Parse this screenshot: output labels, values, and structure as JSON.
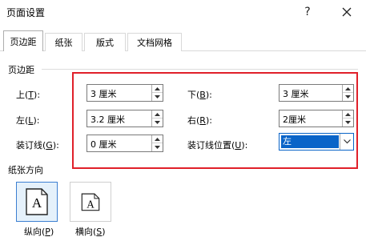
{
  "window": {
    "title": "页面设置"
  },
  "icons": {
    "help": "question-mark-icon",
    "close": "close-x-icon"
  },
  "tabs": [
    {
      "label": "页边距",
      "active": true
    },
    {
      "label": "纸张",
      "active": false
    },
    {
      "label": "版式",
      "active": false
    },
    {
      "label": "文档网格",
      "active": false
    }
  ],
  "margins": {
    "section_title": "页边距",
    "top": {
      "label_pre": "上(",
      "key": "T",
      "label_post": "):",
      "value": "3 厘米"
    },
    "bottom": {
      "label_pre": "下(",
      "key": "B",
      "label_post": "):",
      "value": "3 厘米"
    },
    "left": {
      "label_pre": "左(",
      "key": "L",
      "label_post": "):",
      "value": "3.2 厘米"
    },
    "right": {
      "label_pre": "右(",
      "key": "R",
      "label_post": "):",
      "value": "2厘米"
    },
    "gutter": {
      "label_pre": "装订线(",
      "key": "G",
      "label_post": "):",
      "value": "0 厘米"
    },
    "gutter_position": {
      "label_pre": "装订线位置(",
      "key": "U",
      "label_post": "):",
      "value": "左"
    }
  },
  "orientation": {
    "section_title": "纸张方向",
    "portrait": {
      "label_pre": "纵向(",
      "key": "P",
      "label_post": ")",
      "glyph": "A",
      "selected": true
    },
    "landscape": {
      "label_pre": "横向(",
      "key": "S",
      "label_post": ")",
      "glyph": "A",
      "selected": false
    }
  },
  "colors": {
    "highlight_box": "#e0202a",
    "selection": "#0a64c8"
  }
}
